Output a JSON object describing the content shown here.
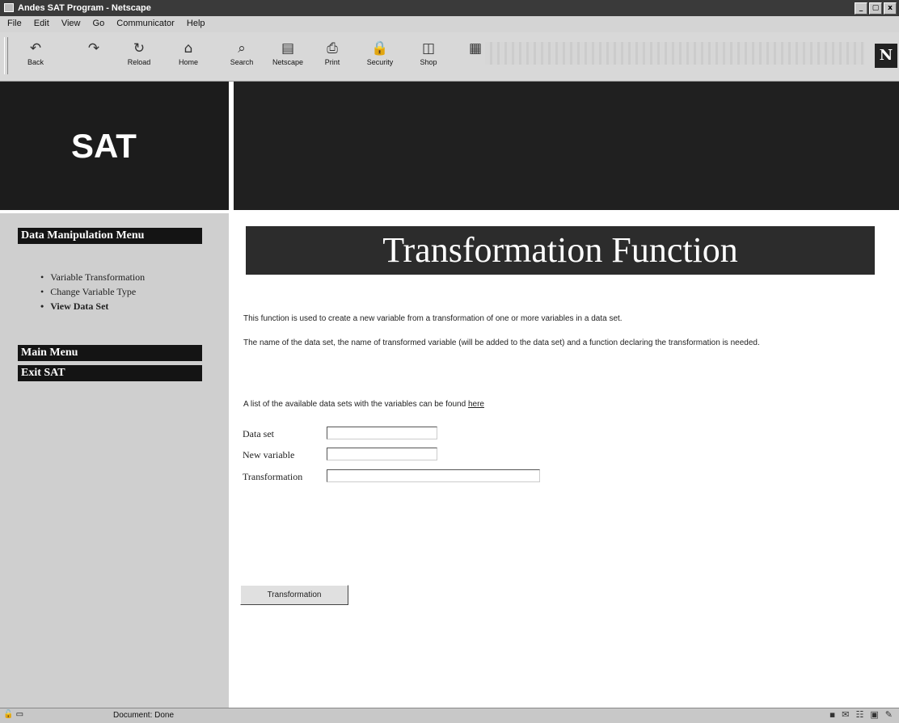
{
  "window": {
    "title": "Andes SAT Program - Netscape",
    "controls": [
      "_",
      "▢",
      "x"
    ]
  },
  "menubar": [
    "File",
    "Edit",
    "View",
    "Go",
    "Communicator",
    "Help"
  ],
  "toolbar": {
    "buttons": [
      {
        "label": "Back",
        "icon": "back-arrow-icon",
        "glyph": "↶"
      },
      {
        "label": "",
        "icon": "forward-arrow-icon",
        "glyph": "↷"
      },
      {
        "label": "Reload",
        "icon": "reload-icon",
        "glyph": "↻"
      },
      {
        "label": "Home",
        "icon": "home-icon",
        "glyph": "⌂"
      },
      {
        "label": "Search",
        "icon": "search-icon",
        "glyph": "⌕"
      },
      {
        "label": "Netscape",
        "icon": "netscape-icon",
        "glyph": "▤"
      },
      {
        "label": "Print",
        "icon": "print-icon",
        "glyph": "⎙"
      },
      {
        "label": "Security",
        "icon": "security-lock-icon",
        "glyph": "🔒"
      },
      {
        "label": "Shop",
        "icon": "shop-bag-icon",
        "glyph": "◫"
      },
      {
        "label": "",
        "icon": "stop-icon",
        "glyph": "▦"
      }
    ],
    "brand_letter": "N"
  },
  "logo": "SAT",
  "sidebar": {
    "data_manipulation_menu": "Data Manipulation Menu",
    "items": [
      {
        "label": "Variable Transformation",
        "bold": false
      },
      {
        "label": "Change Variable Type",
        "bold": false
      },
      {
        "label": "View Data Set",
        "bold": true
      }
    ],
    "main_menu": "Main Menu",
    "exit": "Exit SAT"
  },
  "main": {
    "title": "Transformation Function",
    "p1": "This function is used to create a new variable from a transformation of one or more variables in a data set.",
    "p2": "The name of the data set, the name of transformed variable (will be added to the data set) and a function declaring the transformation is needed.",
    "p3_prefix": "A list of the available data sets with the variables can be found ",
    "p3_link": "here",
    "form": {
      "dataset_label": "Data set",
      "dataset_value": "",
      "newvar_label": "New variable",
      "newvar_value": "",
      "transform_label": "Transformation",
      "transform_value": "",
      "submit_label": "Transformation"
    }
  },
  "statusbar": {
    "status": "Document: Done"
  }
}
